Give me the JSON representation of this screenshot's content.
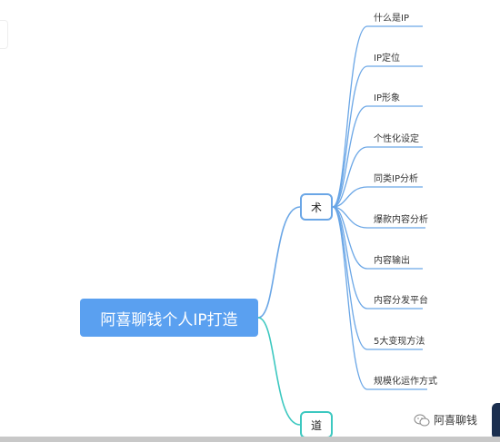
{
  "root": {
    "label": "阿喜聊钱个人IP打造"
  },
  "branches": {
    "shu": "术",
    "dao": "道"
  },
  "leaves": [
    "什么是IP",
    "IP定位",
    "IP形象",
    "个性化设定",
    "同类IP分析",
    "爆款内容分析",
    "内容输出",
    "内容分发平台",
    "5大变现方法",
    "规模化运作方式"
  ],
  "watermark": {
    "text": "阿喜聊钱",
    "icon": "wechat-icon"
  },
  "colors": {
    "root": "#5aa0f0",
    "edge_shu": "#6aa6e6",
    "edge_dao": "#3cc8c0"
  }
}
